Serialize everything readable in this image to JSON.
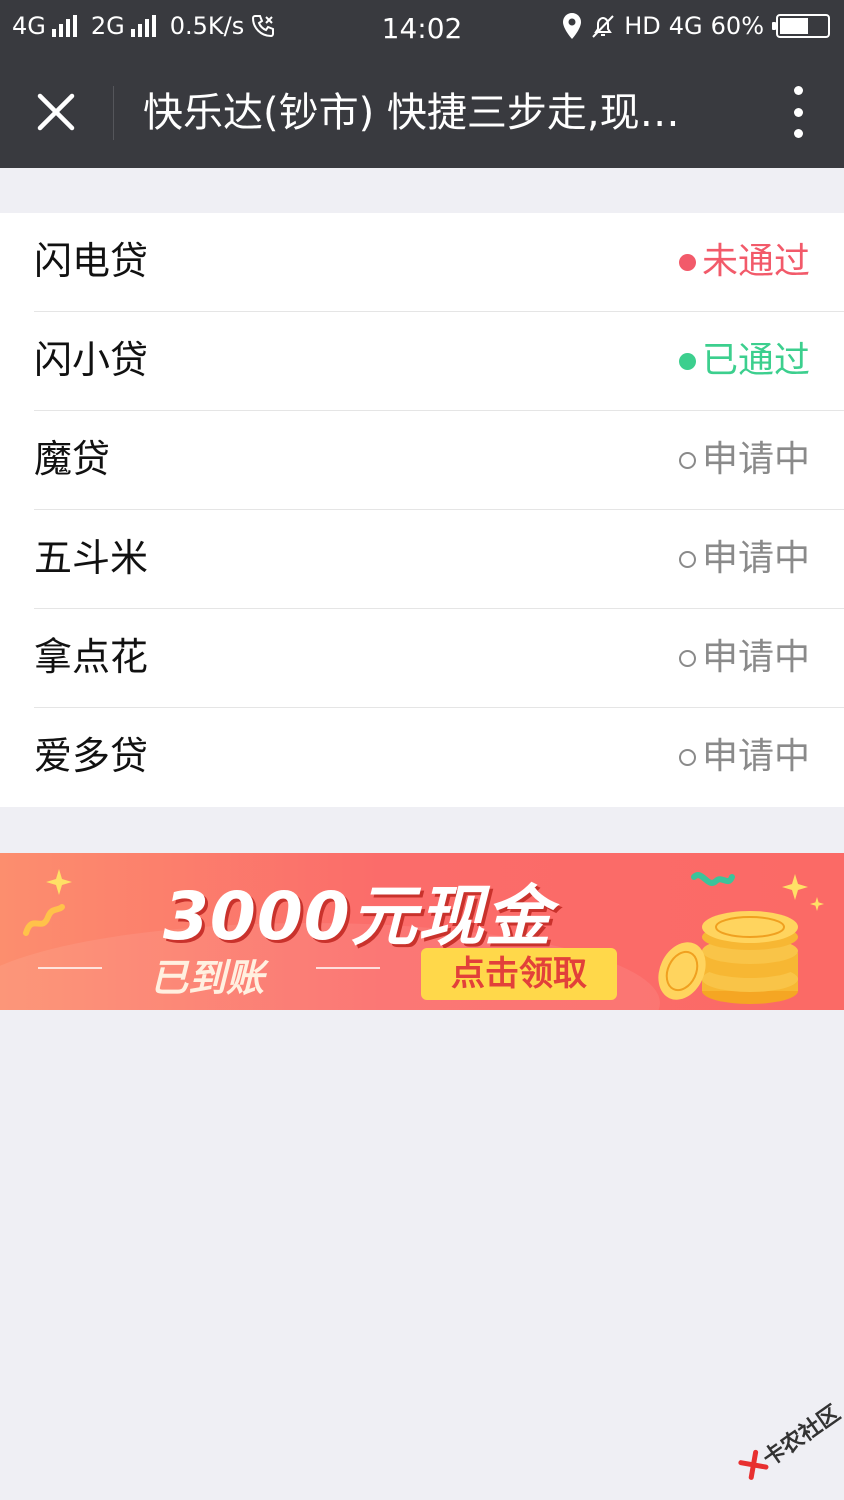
{
  "status_bar": {
    "network_1": "4G",
    "network_2": "2G",
    "speed": "0.5K/s",
    "time": "14:02",
    "hd": "HD",
    "network_3": "4G",
    "battery": "60%",
    "battery_level": 0.6
  },
  "nav": {
    "title": "快乐达(钞市) 快捷三步走,现…",
    "close_icon": "close-icon",
    "more_icon": "more-vertical-icon"
  },
  "list": {
    "items": [
      {
        "name": "闪电贷",
        "status": "未通过",
        "state": "failed"
      },
      {
        "name": "闪小贷",
        "status": "已通过",
        "state": "passed"
      },
      {
        "name": "魔贷",
        "status": "申请中",
        "state": "pending"
      },
      {
        "name": "五斗米",
        "status": "申请中",
        "state": "pending"
      },
      {
        "name": "拿点花",
        "status": "申请中",
        "state": "pending"
      },
      {
        "name": "爱多贷",
        "status": "申请中",
        "state": "pending"
      }
    ]
  },
  "banner": {
    "title": "3000元现金",
    "subtitle": "已到账",
    "cta": "点击领取"
  },
  "watermark": {
    "text": "卡农社区"
  },
  "colors": {
    "failed": "#f25a6a",
    "passed": "#3ccf8e",
    "pending": "#8a8a8a",
    "nav_bg": "#393a3f",
    "page_bg": "#efeff4"
  }
}
